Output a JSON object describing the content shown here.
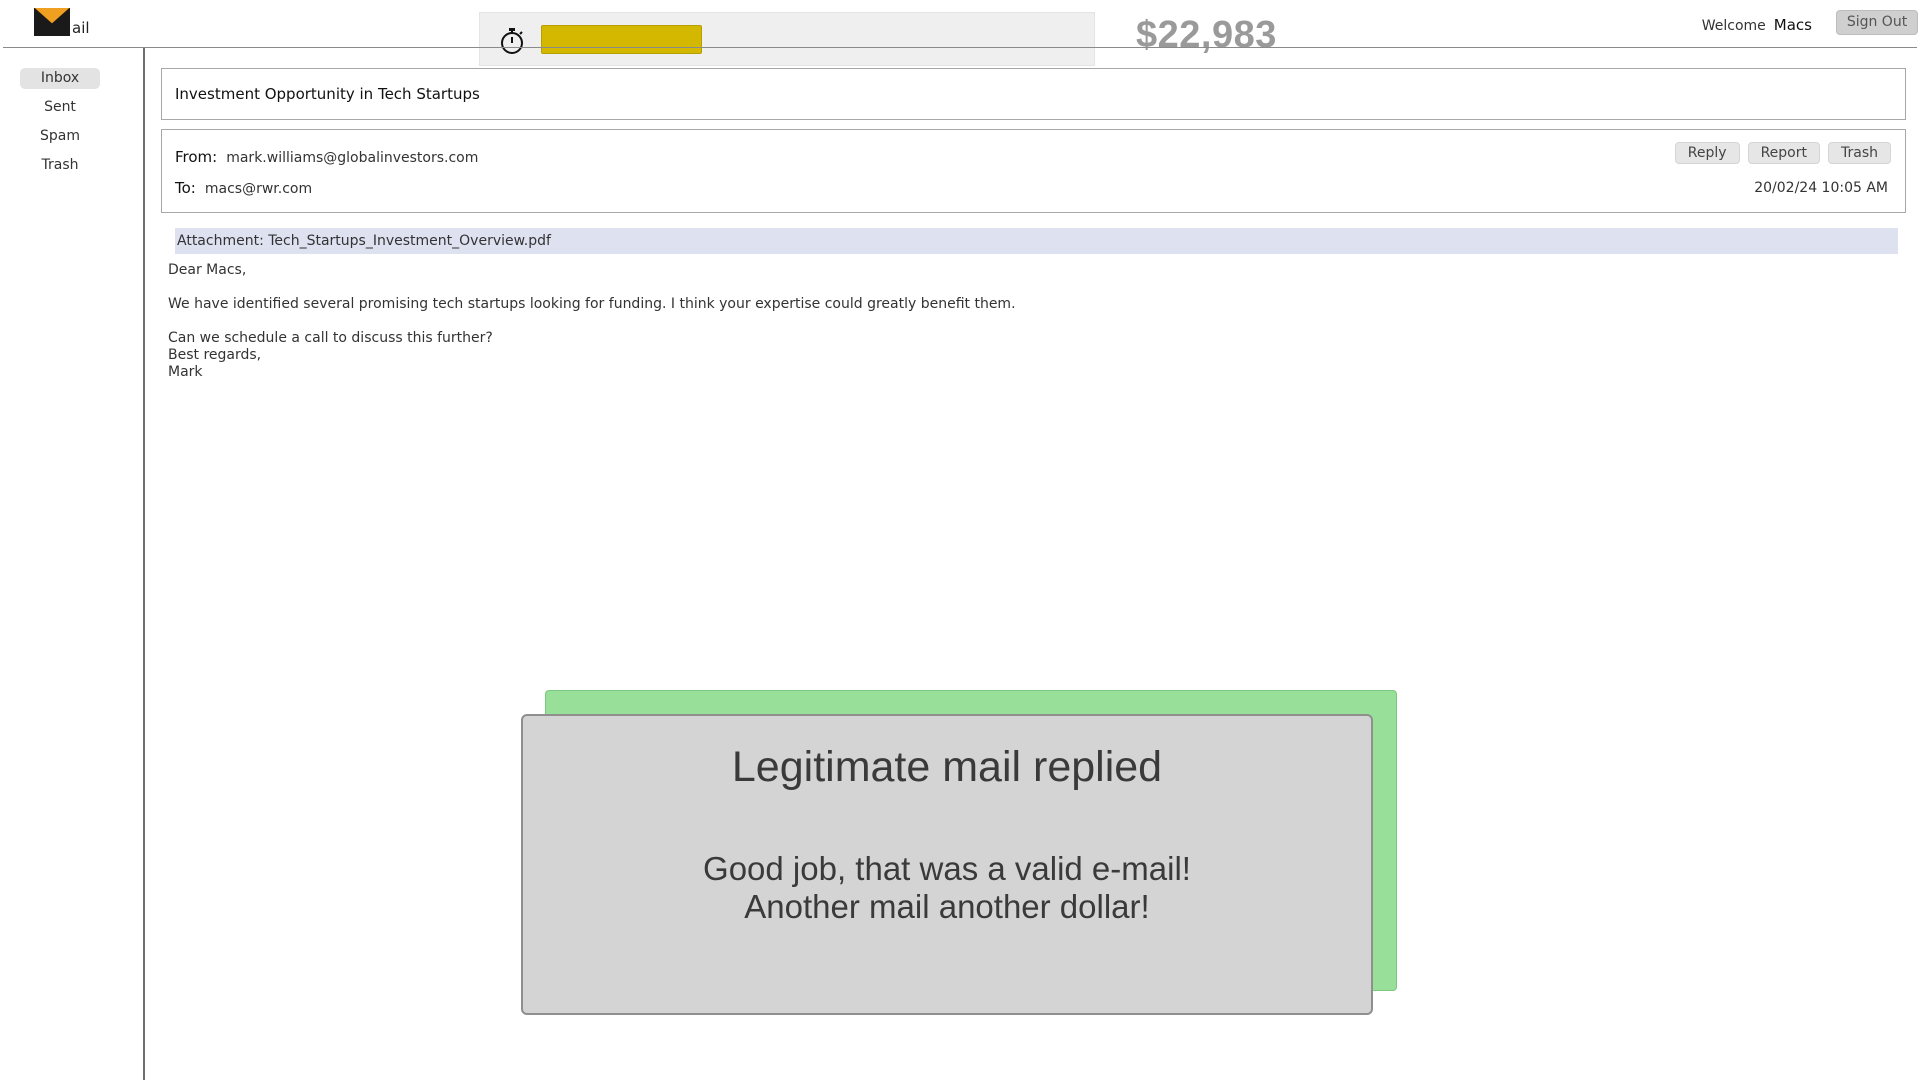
{
  "app": {
    "logo_text": "ail",
    "welcome_label": "Welcome",
    "username": "Macs",
    "sign_out_label": "Sign Out",
    "balance": "$22,983"
  },
  "timer": {
    "remaining_fraction": 0.3,
    "bar_color": "#d4b800",
    "icon": "stopwatch-icon"
  },
  "sidebar": {
    "items": [
      {
        "label": "Inbox",
        "active": true
      },
      {
        "label": "Sent",
        "active": false
      },
      {
        "label": "Spam",
        "active": false
      },
      {
        "label": "Trash",
        "active": false
      }
    ]
  },
  "email": {
    "subject": "Investment Opportunity in Tech Startups",
    "from_label": "From:",
    "from": "mark.williams@globalinvestors.com",
    "to_label": "To:",
    "to": "macs@rwr.com",
    "timestamp": "20/02/24 10:05 AM",
    "actions": [
      "Reply",
      "Report",
      "Trash"
    ],
    "attachment": "Attachment: Tech_Startups_Investment_Overview.pdf",
    "body": [
      "Dear Macs,",
      "We have identified several promising tech startups looking for funding. I think your expertise could greatly benefit them.",
      "Can we schedule a call to discuss this further?",
      "Best regards,",
      "Mark"
    ]
  },
  "result": {
    "title": "Legitimate mail replied",
    "line1": "Good job, that was a valid e-mail!",
    "line2": "Another mail another dollar!",
    "accent_color": "#98e09a"
  }
}
